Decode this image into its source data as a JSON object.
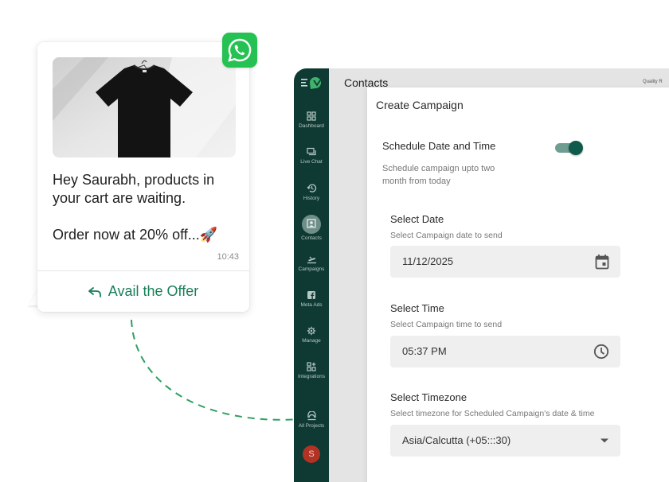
{
  "chat": {
    "message_line1": "Hey Saurabh, products in your cart are waiting.",
    "message_line2": "Order now at 20% off...🚀",
    "time": "10:43",
    "cta_label": "Avail the Offer"
  },
  "app": {
    "page_title": "Contacts",
    "quality_label": "Quality R",
    "sidebar": {
      "items": [
        {
          "label": "Dashboard",
          "icon": "dashboard-icon"
        },
        {
          "label": "Live Chat",
          "icon": "chat-icon"
        },
        {
          "label": "History",
          "icon": "history-icon"
        },
        {
          "label": "Contacts",
          "icon": "contacts-icon"
        },
        {
          "label": "Campaigns",
          "icon": "campaign-icon"
        },
        {
          "label": "Meta Ads",
          "icon": "facebook-icon"
        },
        {
          "label": "Manage",
          "icon": "gear-icon"
        },
        {
          "label": "Integrations",
          "icon": "integrations-icon"
        },
        {
          "label": "All Projects",
          "icon": "projects-icon"
        }
      ],
      "active": "Contacts",
      "avatar_initial": "S"
    }
  },
  "dialog": {
    "title": "Create Campaign",
    "schedule": {
      "label": "Schedule Date and Time",
      "description": "Schedule campaign upto two month from today",
      "enabled": true
    },
    "date": {
      "label": "Select Date",
      "help": "Select Campaign date to send",
      "value": "11/12/2025"
    },
    "time": {
      "label": "Select Time",
      "help": "Select Campaign time to send",
      "value": "05:37 PM"
    },
    "timezone": {
      "label": "Select Timezone",
      "help": "Select timezone for Scheduled Campaign's date & time",
      "value": "Asia/Calcutta (+05:::30)"
    }
  },
  "colors": {
    "sidebar_bg": "#0f3a34",
    "accent_green": "#1a7f5a",
    "whatsapp_green": "#25c253",
    "avatar_red": "#b23224"
  }
}
